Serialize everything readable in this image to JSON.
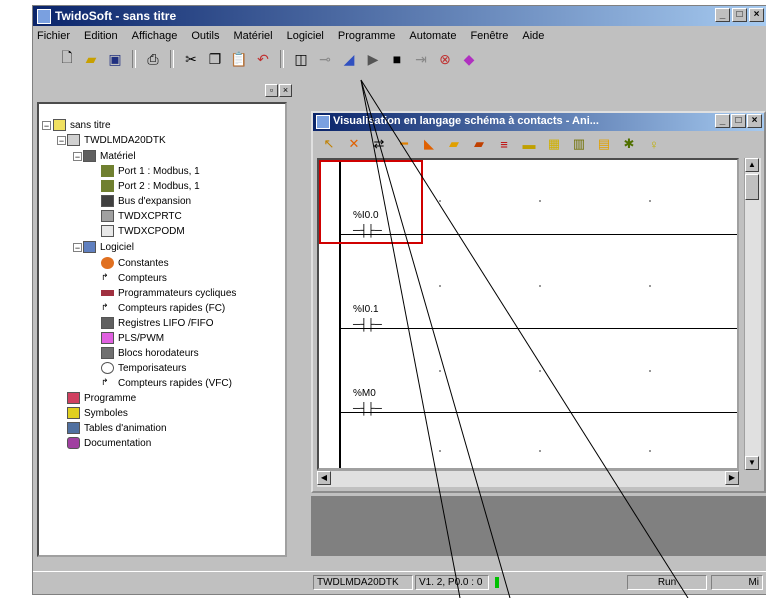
{
  "app": {
    "title": "TwidoSoft - sans titre"
  },
  "menubar": [
    "Fichier",
    "Edition",
    "Affichage",
    "Outils",
    "Matériel",
    "Logiciel",
    "Programme",
    "Automate",
    "Fenêtre",
    "Aide"
  ],
  "toolbar_icons": [
    "new-icon",
    "open-icon",
    "save-icon",
    "print-icon",
    "cut-icon",
    "copy-icon",
    "paste-icon",
    "undo-icon",
    "window-icon",
    "connect-icon",
    "transfer-icon",
    "run-icon",
    "stop-icon",
    "init-icon",
    "debug-icon",
    "animation-icon"
  ],
  "tree": {
    "root": "sans titre",
    "controller": "TWDLMDA20DTK",
    "hardware": "Matériel",
    "hardware_items": [
      "Port 1 : Modbus, 1",
      "Port 2 : Modbus, 1",
      "Bus d'expansion",
      "TWDXCPRTC",
      "TWDXCPODM"
    ],
    "software": "Logiciel",
    "software_items": [
      "Constantes",
      "Compteurs",
      "Programmateurs cycliques",
      "Compteurs rapides (FC)",
      "Registres LIFO /FIFO",
      "PLS/PWM",
      "Blocs horodateurs",
      "Temporisateurs",
      "Compteurs rapides (VFC)"
    ],
    "bottom_items": [
      "Programme",
      "Symboles",
      "Tables d'animation",
      "Documentation"
    ]
  },
  "child_window": {
    "title": "Visualisation en langage schéma à contacts - Ani...",
    "rungs": [
      {
        "label": "%I0.0"
      },
      {
        "label": "%I0.1"
      },
      {
        "label": "%M0"
      }
    ]
  },
  "status": {
    "controller": "TWDLMDA20DTK",
    "version": "V1. 2, P0.0 : 0",
    "mode": "Run",
    "extra": "Mi"
  },
  "colors": {
    "title_start": "#0a246a",
    "title_end": "#a6caf0",
    "selection": "#d00000",
    "run_indicator": "#00c000"
  }
}
